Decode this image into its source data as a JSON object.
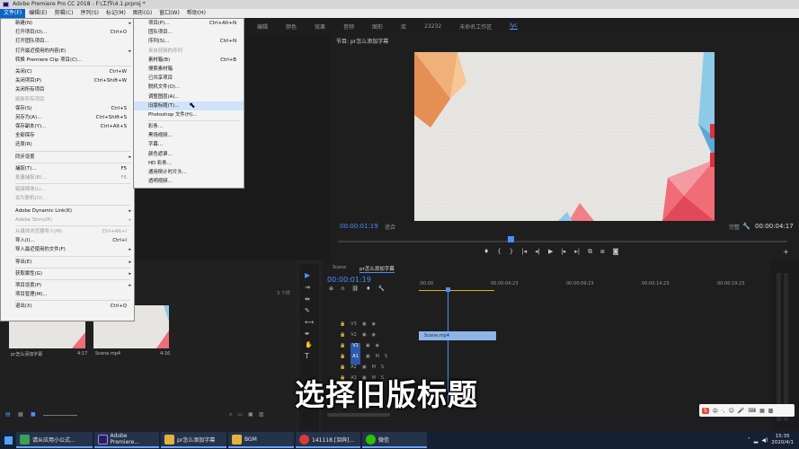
{
  "window": {
    "title": "Adobe Premiere Pro CC 2018 - F:\\工作\\4.1.prproj *"
  },
  "menubar": {
    "items": [
      "文件(F)",
      "编辑(E)",
      "剪辑(C)",
      "序列(S)",
      "标记(M)",
      "图形(G)",
      "窗口(W)",
      "帮助(H)"
    ]
  },
  "workspace_tabs": [
    "编辑",
    "颜色",
    "效果",
    "音频",
    "图形",
    "库",
    "23232",
    "未命名工作区",
    "lyc"
  ],
  "file_menu": [
    {
      "label": "新建(N)",
      "shortcut": "",
      "sub": true
    },
    {
      "label": "打开项目(O)...",
      "shortcut": "Ctrl+O"
    },
    {
      "label": "打开团队项目...",
      "shortcut": ""
    },
    {
      "label": "打开最近使用的内容(E)",
      "shortcut": "",
      "sub": true
    },
    {
      "label": "转换 Premiere Clip 项目(C)...",
      "shortcut": ""
    },
    {
      "sep": true
    },
    {
      "label": "关闭(C)",
      "shortcut": "Ctrl+W"
    },
    {
      "label": "关闭项目(P)",
      "shortcut": "Ctrl+Shift+W"
    },
    {
      "label": "关闭所有项目",
      "shortcut": ""
    },
    {
      "label": "刷新所有项目",
      "shortcut": "",
      "dis": true
    },
    {
      "label": "保存(S)",
      "shortcut": "Ctrl+S"
    },
    {
      "label": "另存为(A)...",
      "shortcut": "Ctrl+Shift+S"
    },
    {
      "label": "保存副本(Y)...",
      "shortcut": "Ctrl+Alt+S"
    },
    {
      "label": "全部保存",
      "shortcut": ""
    },
    {
      "label": "还原(R)",
      "shortcut": ""
    },
    {
      "sep": true
    },
    {
      "label": "同步设置",
      "shortcut": "",
      "sub": true
    },
    {
      "sep": true
    },
    {
      "label": "捕捉(T)...",
      "shortcut": "F5"
    },
    {
      "label": "批量捕捉(B)...",
      "shortcut": "F6",
      "dis": true
    },
    {
      "sep": true
    },
    {
      "label": "链接媒体(L)...",
      "shortcut": "",
      "dis": true
    },
    {
      "label": "设为脱机(O)...",
      "shortcut": "",
      "dis": true
    },
    {
      "sep": true
    },
    {
      "label": "Adobe Dynamic Link(K)",
      "shortcut": "",
      "sub": true
    },
    {
      "label": "Adobe Story(R)",
      "shortcut": "",
      "sub": true,
      "dis": true
    },
    {
      "sep": true
    },
    {
      "label": "从媒体浏览器导入(M)",
      "shortcut": "Ctrl+Alt+I",
      "dis": true
    },
    {
      "label": "导入(I)...",
      "shortcut": "Ctrl+I"
    },
    {
      "label": "导入最近使用的文件(F)",
      "shortcut": "",
      "sub": true
    },
    {
      "sep": true
    },
    {
      "label": "导出(E)",
      "shortcut": "",
      "sub": true
    },
    {
      "sep": true
    },
    {
      "label": "获取属性(G)",
      "shortcut": "",
      "sub": true
    },
    {
      "sep": true
    },
    {
      "label": "项目设置(P)",
      "shortcut": "",
      "sub": true
    },
    {
      "label": "项目管理(M)...",
      "shortcut": ""
    },
    {
      "sep": true
    },
    {
      "label": "退出(X)",
      "shortcut": "Ctrl+Q"
    }
  ],
  "new_submenu": [
    {
      "label": "项目(P)...",
      "shortcut": "Ctrl+Alt+N"
    },
    {
      "label": "团队项目...",
      "shortcut": ""
    },
    {
      "label": "序列(S)...",
      "shortcut": "Ctrl+N"
    },
    {
      "label": "来自剪辑的序列",
      "shortcut": "",
      "dis": true
    },
    {
      "label": "素材箱(B)",
      "shortcut": "Ctrl+B"
    },
    {
      "label": "搜索素材箱",
      "shortcut": ""
    },
    {
      "label": "已共享项目",
      "shortcut": ""
    },
    {
      "label": "脱机文件(O)...",
      "shortcut": ""
    },
    {
      "label": "调整图层(A)...",
      "shortcut": ""
    },
    {
      "label": "旧版标题(T)...",
      "shortcut": "",
      "hl": true
    },
    {
      "label": "Photoshop 文件(H)...",
      "shortcut": ""
    },
    {
      "sep": true
    },
    {
      "label": "彩条...",
      "shortcut": ""
    },
    {
      "label": "黑场视频...",
      "shortcut": ""
    },
    {
      "label": "字幕...",
      "shortcut": ""
    },
    {
      "label": "颜色遮罩...",
      "shortcut": ""
    },
    {
      "label": "HD 彩条...",
      "shortcut": ""
    },
    {
      "label": "通用倒计时片头...",
      "shortcut": ""
    },
    {
      "label": "透明视频...",
      "shortcut": ""
    }
  ],
  "program": {
    "title": "节目: pr怎么添加字幕",
    "timecode_left": "00:00:01:19",
    "fit": "适合",
    "quality": "完整",
    "timecode_right": "00:00:04:17"
  },
  "project": {
    "count": "3 个项",
    "items": [
      {
        "name": "pr怎么添加字幕",
        "duration": "4:17"
      },
      {
        "name": "Scene.mp4",
        "duration": "4:16"
      }
    ]
  },
  "timeline": {
    "tabs": [
      "Scene",
      "pr怎么添加字幕"
    ],
    "timecode": "00:00:01:19",
    "ruler": [
      ":00:00",
      "00:00:04:23",
      "00:00:09:23",
      "00:00:14:23",
      "00:00:19:23"
    ],
    "tracks": [
      "V3",
      "V2",
      "V1",
      "A1",
      "A2",
      "A3"
    ],
    "clip": "Scene.mp4"
  },
  "subtitle": "选择旧版标题",
  "taskbar": {
    "items": [
      "请从应用小公式...",
      "Adobe Premiere...",
      "pr怎么添加字幕",
      "BGM",
      "141118.[泪奔]...",
      "微信"
    ],
    "clock_time": "15:35",
    "clock_date": "2020/4/1"
  },
  "colors": {
    "accent": "#4a8dff",
    "menu_highlight": "#cfe4fb",
    "timecode": "#4a8dff"
  }
}
